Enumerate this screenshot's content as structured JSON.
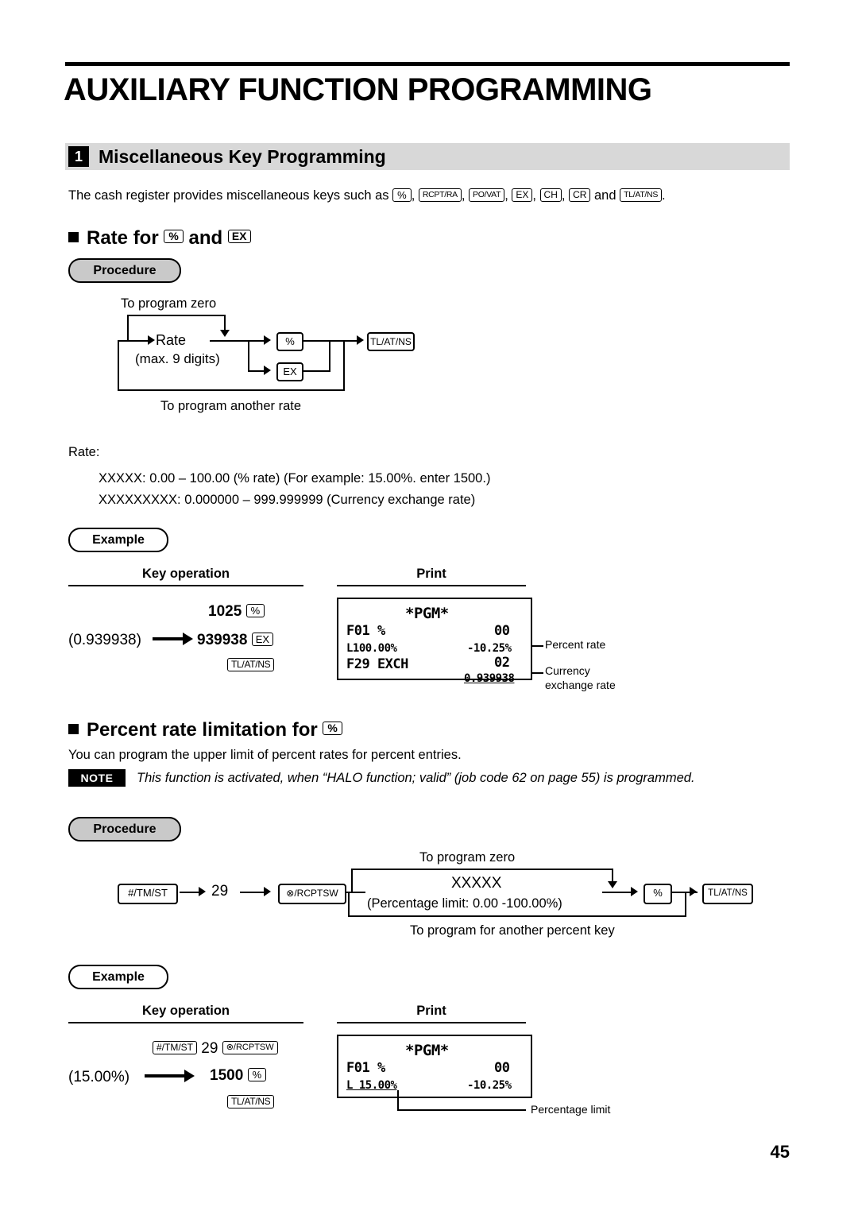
{
  "page": {
    "title": "AUXILIARY FUNCTION PROGRAMMING",
    "number": "45"
  },
  "section": {
    "num": "1",
    "title": "Miscellaneous Key Programming",
    "intro_before": "The cash register provides miscellaneous keys such as",
    "intro_keys": [
      "%",
      "RCPT/RA",
      "PO/VAT",
      "EX",
      "CH",
      "CR"
    ],
    "intro_and": "and",
    "intro_last_key": "TL/AT/NS",
    "intro_end": "."
  },
  "rate_block": {
    "heading_before": "Rate for",
    "heading_key1": "%",
    "heading_and": "and",
    "heading_key2": "EX",
    "procedure_label": "Procedure",
    "flow": {
      "top_label": "To program zero",
      "rate_label": "Rate",
      "rate_sub": "(max. 9 digits)",
      "key_pct": "%",
      "key_ex": "EX",
      "key_tl": "TL/AT/NS",
      "bottom_label": "To program another rate"
    },
    "rate_caption": "Rate:",
    "rate_line1": "XXXXX: 0.00 – 100.00 (% rate) (For example: 15.00%. enter 1500.)",
    "rate_line2": "XXXXXXXXX: 0.000000 – 999.999999 (Currency exchange rate)",
    "example_label": "Example",
    "col_key_operation": "Key operation",
    "col_print": "Print",
    "keyop_row1_value": "1025",
    "keyop_row1_key": "%",
    "keyop_row2_paren": "(0.939938)",
    "keyop_row2_value": "939938",
    "keyop_row2_key": "EX",
    "keyop_row3_key": "TL/AT/NS",
    "receipt": {
      "title": "*PGM*",
      "l1_left": "F01 %",
      "l1_right": "00",
      "l2_left": "L100.00%",
      "l2_right": "-10.25%",
      "l3_left": "F29 EXCH",
      "l3_right": "02",
      "l4_right": "0.939938"
    },
    "callout_percent_rate": "Percent rate",
    "callout_currency_1": "Currency",
    "callout_currency_2": "exchange rate"
  },
  "limit_block": {
    "heading_before": "Percent rate limitation for",
    "heading_key": "%",
    "desc": "You can program the upper limit of percent rates for percent entries.",
    "note_badge": "NOTE",
    "note_text": "This function is activated, when “HALO function; valid” (job code 62 on page 55) is programmed.",
    "procedure_label": "Procedure",
    "flow": {
      "key_tmst": "#/TM/ST",
      "num29": "29",
      "key_rcptsw": "⊗/RCPTSW",
      "top_label": "To program zero",
      "xxxxx": "XXXXX",
      "range": "(Percentage limit: 0.00 -100.00%)",
      "bottom_label": "To program for another percent key",
      "key_pct": "%",
      "key_tl": "TL/AT/NS"
    },
    "example_label": "Example",
    "col_key_operation": "Key operation",
    "col_print": "Print",
    "keyop_row1_key1": "#/TM/ST",
    "keyop_row1_num": "29",
    "keyop_row1_key2": "⊗/RCPTSW",
    "keyop_row2_paren": "(15.00%)",
    "keyop_row2_value": "1500",
    "keyop_row2_key": "%",
    "keyop_row3_key": "TL/AT/NS",
    "receipt": {
      "title": "*PGM*",
      "l1_left": "F01 %",
      "l1_right": "00",
      "l2_left": "L 15.00%",
      "l2_right": "-10.25%"
    },
    "callout_percentage_limit": "Percentage limit"
  }
}
